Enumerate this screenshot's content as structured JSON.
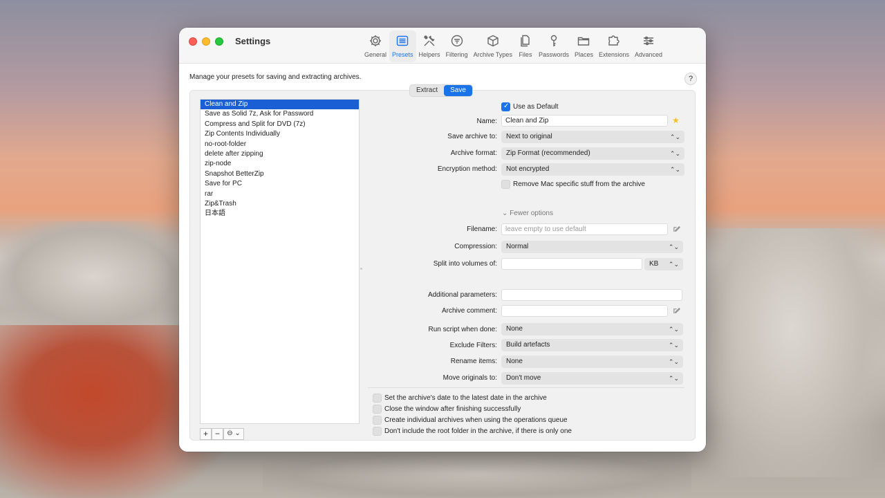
{
  "window": {
    "title": "Settings"
  },
  "toolbar": {
    "items": [
      {
        "label": "General",
        "icon": "gear-icon",
        "active": false
      },
      {
        "label": "Presets",
        "icon": "presets-list-icon",
        "active": true
      },
      {
        "label": "Helpers",
        "icon": "tools-icon",
        "active": false
      },
      {
        "label": "Filtering",
        "icon": "filter-icon",
        "active": false
      },
      {
        "label": "Archive Types",
        "icon": "box-icon",
        "active": false
      },
      {
        "label": "Files",
        "icon": "files-icon",
        "active": false
      },
      {
        "label": "Passwords",
        "icon": "key-icon",
        "active": false
      },
      {
        "label": "Places",
        "icon": "folder-icon",
        "active": false
      },
      {
        "label": "Extensions",
        "icon": "puzzle-icon",
        "active": false
      },
      {
        "label": "Advanced",
        "icon": "sliders-icon",
        "active": false
      }
    ]
  },
  "description": "Manage your presets for saving and extracting archives.",
  "help": "?",
  "segment": {
    "extract": "Extract",
    "save": "Save",
    "selected": "Save"
  },
  "presets": [
    "Clean and Zip",
    "Save as Solid 7z, Ask for Password",
    "Compress and Split for DVD (7z)",
    "Zip Contents Individually",
    "no-root-folder",
    "delete after zipping",
    "zip-node",
    "Snapshot BetterZip",
    "Save for PC",
    "rar",
    "Zip&Trash",
    "日本語"
  ],
  "selected_preset": "Clean and Zip",
  "list_footer": {
    "add": "+",
    "remove": "−",
    "more": "⊖ ⌄"
  },
  "form": {
    "use_default": {
      "label": "Use as Default",
      "checked": true
    },
    "name": {
      "label": "Name:",
      "value": "Clean and Zip"
    },
    "save_to": {
      "label": "Save archive to:",
      "value": "Next to original"
    },
    "format": {
      "label": "Archive format:",
      "value": "Zip Format (recommended)"
    },
    "encryption": {
      "label": "Encryption method:",
      "value": "Not encrypted"
    },
    "remove_mac": {
      "label": "Remove Mac specific stuff from the archive",
      "checked": false
    },
    "fewer_options": "Fewer options",
    "filename": {
      "label": "Filename:",
      "placeholder": "leave empty to use default"
    },
    "compression": {
      "label": "Compression:",
      "value": "Normal"
    },
    "split": {
      "label": "Split into volumes of:",
      "value": "",
      "unit": "KB"
    },
    "additional": {
      "label": "Additional parameters:",
      "value": ""
    },
    "comment": {
      "label": "Archive comment:",
      "value": ""
    },
    "run_script": {
      "label": "Run script when done:",
      "value": "None"
    },
    "exclude": {
      "label": "Exclude Filters:",
      "value": "Build artefacts"
    },
    "rename": {
      "label": "Rename items:",
      "value": "None"
    },
    "move": {
      "label": "Move originals to:",
      "value": "Don't move"
    }
  },
  "options": [
    {
      "label": "Set the archive's date to the latest date in the archive",
      "checked": false
    },
    {
      "label": "Close the window after finishing successfully",
      "checked": false
    },
    {
      "label": "Create individual archives when using the operations queue",
      "checked": false
    },
    {
      "label": "Don't include the root folder in the archive, if there is only one",
      "checked": false
    }
  ],
  "colors": {
    "accent": "#1a73e8",
    "selection": "#1a5fd4"
  }
}
